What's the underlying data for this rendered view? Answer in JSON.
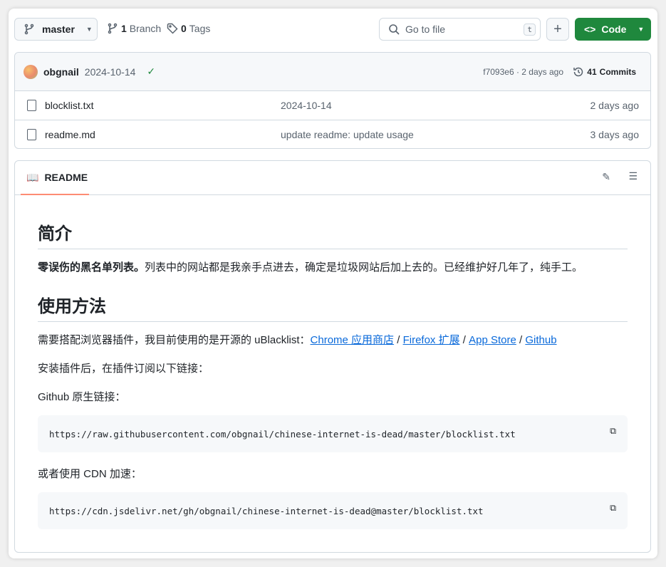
{
  "toolbar": {
    "branch": "master",
    "branch_count": "1",
    "branch_label": "Branch",
    "tag_count": "0",
    "tag_label": "Tags",
    "search_placeholder": "Go to file",
    "search_shortcut": "t",
    "add": "+",
    "code": "Code"
  },
  "commit": {
    "author": "obgnail",
    "message": "2024-10-14",
    "hash": "f7093e6 · 2 days ago",
    "commits_count": "41",
    "commits_label": "Commits",
    "status": "success"
  },
  "files": [
    {
      "name": "blocklist.txt",
      "message": "2024-10-14",
      "time": "2 days ago"
    },
    {
      "name": "readme.md",
      "message": "update readme: update usage",
      "time": "3 days ago"
    }
  ],
  "readme": {
    "tab": "README",
    "h1": "简介",
    "intro_bold": "零误伤的黑名单列表。",
    "intro_rest": "列表中的网站都是我亲手点进去，确定是垃圾网站后加上去的。已经维护好几年了，纯手工。",
    "h2": "使用方法",
    "usage_text": "需要搭配浏览器插件，我目前使用的是开源的 uBlacklist：",
    "links": [
      "Chrome 应用商店",
      "Firefox 扩展",
      "App Store",
      "Github"
    ],
    "sep": " / ",
    "install": "安装插件后，在插件订阅以下链接：",
    "github_label": "Github 原生链接：",
    "url1": "https://raw.githubusercontent.com/obgnail/chinese-internet-is-dead/master/blocklist.txt",
    "cdn_label": "或者使用 CDN 加速：",
    "url2": "https://cdn.jsdelivr.net/gh/obgnail/chinese-internet-is-dead@master/blocklist.txt"
  },
  "colors": {
    "accent": "#1f883d",
    "link": "#0969da",
    "tab_underline": "#fd8c73"
  }
}
